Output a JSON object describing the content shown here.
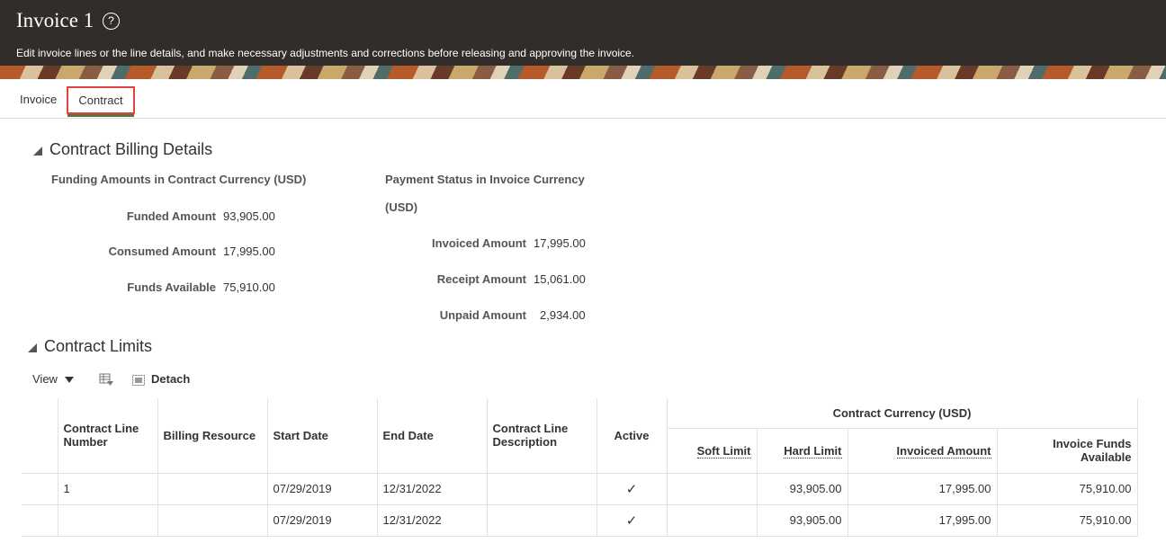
{
  "header": {
    "title": "Invoice 1",
    "help_icon": "?",
    "description": "Edit invoice lines or the line details, and make necessary adjustments and corrections before releasing and approving the invoice."
  },
  "tabs": [
    {
      "label": "Invoice",
      "active": false
    },
    {
      "label": "Contract",
      "active": true
    }
  ],
  "billing_details": {
    "title": "Contract Billing Details",
    "funding": {
      "label": "Funding Amounts in Contract Currency (USD)",
      "fields": [
        {
          "label": "Funded Amount",
          "value": "93,905.00"
        },
        {
          "label": "Consumed Amount",
          "value": "17,995.00"
        },
        {
          "label": "Funds Available",
          "value": "75,910.00"
        }
      ]
    },
    "payment": {
      "label_line1": "Payment Status in Invoice Currency",
      "label_line2": "(USD)",
      "fields": [
        {
          "label": "Invoiced Amount",
          "value": "17,995.00"
        },
        {
          "label": "Receipt Amount",
          "value": "15,061.00"
        },
        {
          "label": "Unpaid Amount",
          "value": "2,934.00"
        }
      ]
    }
  },
  "limits": {
    "title": "Contract Limits",
    "toolbar": {
      "view_label": "View",
      "detach_label": "Detach"
    },
    "columns": {
      "contract_line_number": "Contract Line Number",
      "billing_resource": "Billing Resource",
      "start_date": "Start Date",
      "end_date": "End Date",
      "contract_line_description": "Contract Line Description",
      "active": "Active",
      "group": "Contract Currency (USD)",
      "soft_limit": "Soft Limit",
      "hard_limit": "Hard Limit",
      "invoiced_amount": "Invoiced Amount",
      "invoice_funds_available": "Invoice Funds Available"
    },
    "rows": [
      {
        "line": "1",
        "resource": "",
        "start": "07/29/2019",
        "end": "12/31/2022",
        "desc": "",
        "active": "✓",
        "soft": "",
        "hard": "93,905.00",
        "invoiced": "17,995.00",
        "available": "75,910.00"
      },
      {
        "line": "",
        "resource": "",
        "start": "07/29/2019",
        "end": "12/31/2022",
        "desc": "",
        "active": "✓",
        "soft": "",
        "hard": "93,905.00",
        "invoiced": "17,995.00",
        "available": "75,910.00"
      }
    ]
  }
}
